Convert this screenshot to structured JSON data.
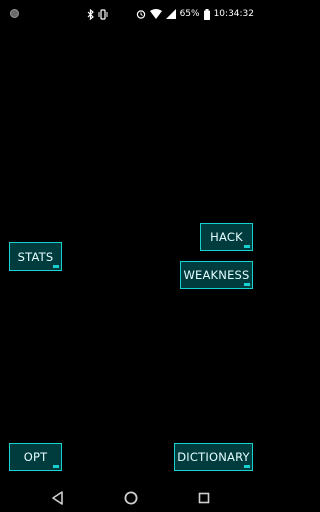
{
  "status_bar": {
    "battery_percent": "65%",
    "time": "10:34:32",
    "icons": [
      "notification-dot-icon",
      "bluetooth-icon",
      "vibrate-icon",
      "alarm-icon",
      "wifi-icon",
      "signal-icon",
      "battery-icon"
    ]
  },
  "buttons": {
    "stats": "STATS",
    "hack": "HACK",
    "weakness": "WEAKNESS",
    "opt": "OPT",
    "dictionary": "DICTIONARY"
  },
  "colors": {
    "accent": "#18d2cf",
    "button_fill": "#003b3e",
    "background": "#000000"
  },
  "nav_bar": {
    "icons": [
      "back-icon",
      "home-icon",
      "recents-icon"
    ]
  }
}
